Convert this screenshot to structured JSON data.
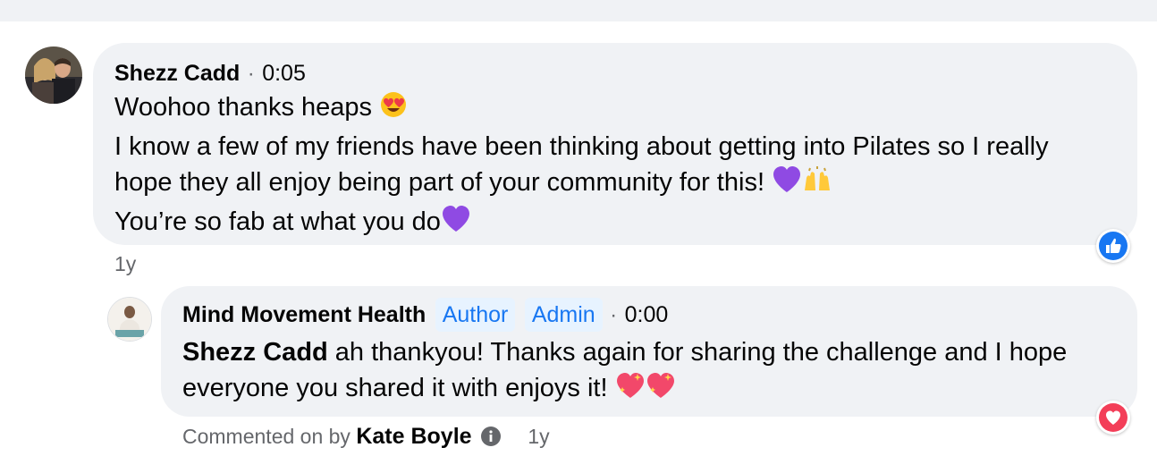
{
  "comment": {
    "author": "Shezz Cadd",
    "separator": "·",
    "time": "0:05",
    "lines": [
      "Woohoo thanks heaps",
      "I know a few of my friends have been thinking about getting into Pilates so I really",
      "hope they all enjoy being part of your community for this!",
      "You’re so fab at what you do"
    ],
    "emojis": [
      "heart-eyes-emoji",
      "purple-heart-emoji",
      "raising-hands-emoji",
      "purple-heart-emoji"
    ],
    "age": "1y",
    "reaction": "like-reaction-icon",
    "colors": {
      "like": "#1877f2",
      "purple_heart": "#8f4ae3"
    }
  },
  "reply": {
    "author": "Mind Movement Health",
    "badges": [
      "Author",
      "Admin"
    ],
    "separator": "·",
    "time": "0:00",
    "mention": "Shezz Cadd",
    "line1": " ah thankyou! Thanks again for sharing the challenge and I hope",
    "line2": "everyone you shared it with enjoys it!",
    "emojis": [
      "sparkling-heart-emoji",
      "sparkling-heart-emoji"
    ],
    "footer_prefix": "Commented on by",
    "footer_name": "Kate Boyle",
    "age": "1y",
    "reaction": "love-reaction-icon",
    "colors": {
      "love": "#f33e58"
    }
  }
}
